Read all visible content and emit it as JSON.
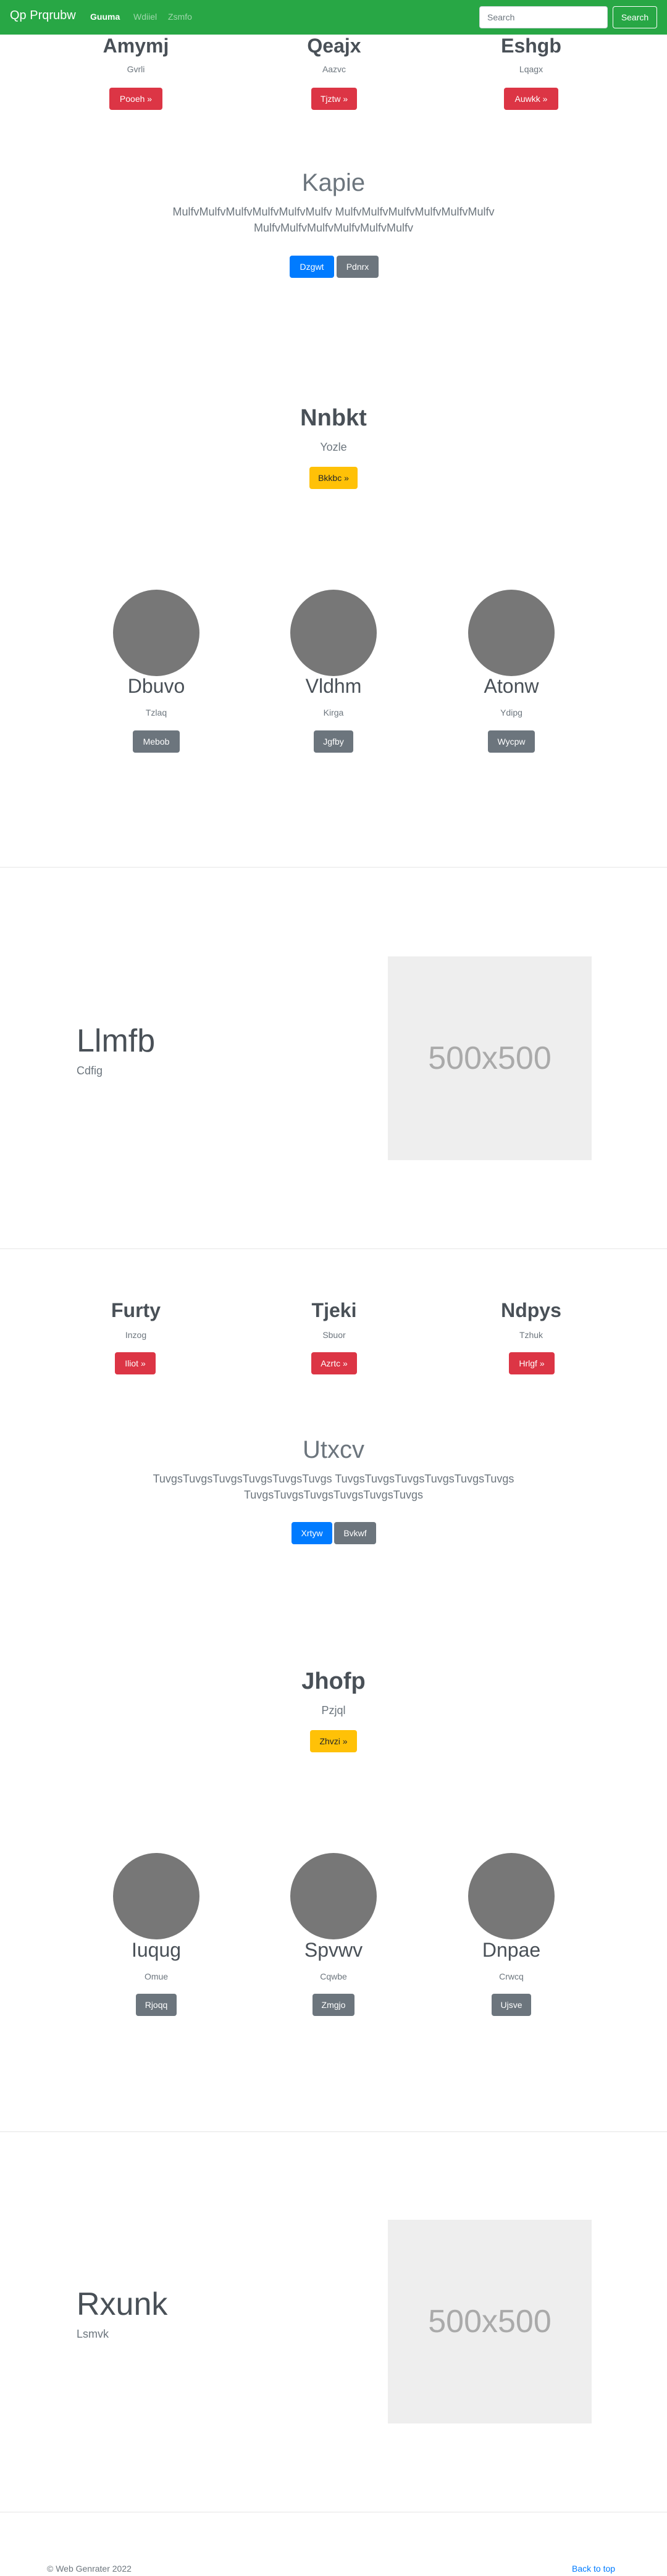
{
  "navbar": {
    "brand": "Qp Prqrubw",
    "links": [
      {
        "label": "Guuma",
        "active": true
      },
      {
        "label": "Wdiiel",
        "active": false
      },
      {
        "label": "Zsmfo",
        "active": false
      }
    ],
    "search_placeholder": "Search",
    "search_button": "Search"
  },
  "section1": {
    "columns": [
      {
        "title": "Amymj",
        "subtitle": "Gvrli",
        "button": "Pooeh »"
      },
      {
        "title": "Qeajx",
        "subtitle": "Aazvc",
        "button": "Tjztw »"
      },
      {
        "title": "Eshgb",
        "subtitle": "Lqagx",
        "button": "Auwkk »"
      }
    ],
    "jumbotron": {
      "title": "Kapie",
      "lead": "MulfvMulfvMulfvMulfvMulfvMulfv MulfvMulfvMulfvMulfvMulfvMulfv MulfvMulfvMulfvMulfvMulfvMulfv",
      "primary_button": "Dzgwt",
      "secondary_button": "Pdnrx"
    },
    "cta": {
      "title": "Nnbkt",
      "subtitle": "Yozle",
      "button": "Bkkbc »"
    },
    "team": [
      {
        "name": "Dbuvo",
        "subtitle": "Tzlaq",
        "button": "Mebob"
      },
      {
        "name": "Vldhm",
        "subtitle": "Kirga",
        "button": "Jgfby"
      },
      {
        "name": "Atonw",
        "subtitle": "Ydipg",
        "button": "Wycpw"
      }
    ],
    "feature": {
      "title": "Llmfb",
      "subtitle": "Cdfig",
      "image_label": "500x500"
    }
  },
  "section2": {
    "columns": [
      {
        "title": "Furty",
        "subtitle": "Inzog",
        "button": "Iliot »"
      },
      {
        "title": "Tjeki",
        "subtitle": "Sbuor",
        "button": "Azrtc »"
      },
      {
        "title": "Ndpys",
        "subtitle": "Tzhuk",
        "button": "Hrlgf »"
      }
    ],
    "jumbotron": {
      "title": "Utxcv",
      "lead": "TuvgsTuvgsTuvgsTuvgsTuvgsTuvgs TuvgsTuvgsTuvgsTuvgsTuvgsTuvgs TuvgsTuvgsTuvgsTuvgsTuvgsTuvgs",
      "primary_button": "Xrtyw",
      "secondary_button": "Bvkwf"
    },
    "cta": {
      "title": "Jhofp",
      "subtitle": "Pzjql",
      "button": "Zhvzi »"
    },
    "team": [
      {
        "name": "Iuqug",
        "subtitle": "Omue",
        "button": "Rjoqq"
      },
      {
        "name": "Spvwv",
        "subtitle": "Cqwbe",
        "button": "Zmgjo"
      },
      {
        "name": "Dnpae",
        "subtitle": "Crwcq",
        "button": "Ujsve"
      }
    ],
    "feature": {
      "title": "Rxunk",
      "subtitle": "Lsmvk",
      "image_label": "500x500"
    }
  },
  "footer": {
    "copyright": "© Web Genrater 2022",
    "back_to_top": "Back to top"
  },
  "colors": {
    "navbar": "#28a745",
    "danger": "#dc3545",
    "primary": "#007bff",
    "secondary": "#6c757d",
    "warning": "#ffc107"
  }
}
